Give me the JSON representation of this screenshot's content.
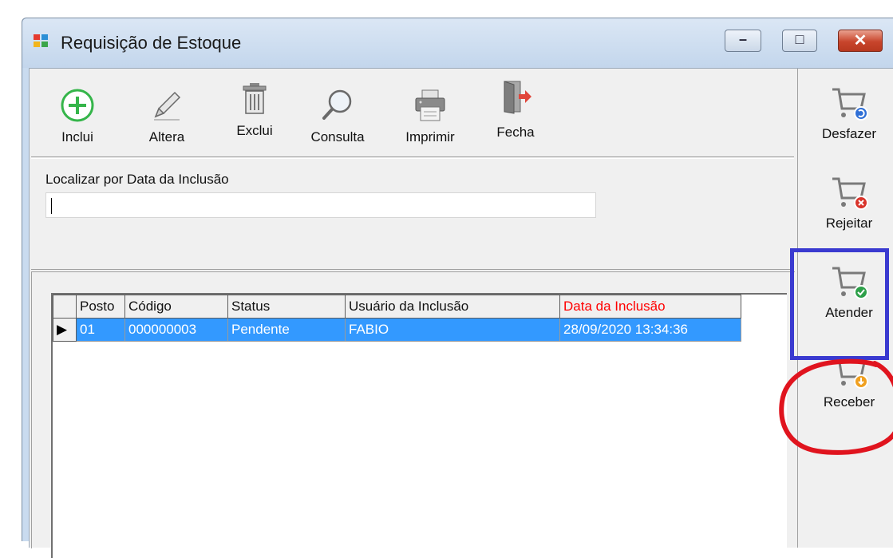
{
  "window": {
    "title": "Requisição de Estoque",
    "min_glyph": "–",
    "max_glyph": "□",
    "close_glyph": "✕"
  },
  "toolbar": {
    "items": [
      {
        "label": "Inclui",
        "icon": "add-circle-icon"
      },
      {
        "label": "Altera",
        "icon": "pencil-icon"
      },
      {
        "label": "Exclui",
        "icon": "trash-icon"
      },
      {
        "label": "Consulta",
        "icon": "magnifier-icon"
      },
      {
        "label": "Imprimir",
        "icon": "printer-icon"
      },
      {
        "label": "Fecha",
        "icon": "exit-door-icon"
      }
    ]
  },
  "search": {
    "label": "Localizar por Data da Inclusão",
    "value": ""
  },
  "grid": {
    "columns": [
      "Posto",
      "Código",
      "Status",
      "Usuário da Inclusão",
      "Data da Inclusão"
    ],
    "rows": [
      {
        "posto": "01",
        "codigo": "000000003",
        "status": "Pendente",
        "usuario": "FABIO",
        "data": "28/09/2020 13:34:36"
      }
    ],
    "row_indicator": "▶"
  },
  "side": {
    "items": [
      {
        "label": "Desfazer",
        "icon": "cart-undo-icon",
        "badge_color": "#2f6fd6"
      },
      {
        "label": "Rejeitar",
        "icon": "cart-reject-icon",
        "badge_color": "#d9342b"
      },
      {
        "label": "Atender",
        "icon": "cart-check-icon",
        "badge_color": "#2ea04a"
      },
      {
        "label": "Receber",
        "icon": "cart-receive-icon",
        "badge_color": "#f0a020"
      }
    ]
  },
  "annotations": {
    "rect_color": "#3a3ad0",
    "oval_color": "#e0141e"
  }
}
